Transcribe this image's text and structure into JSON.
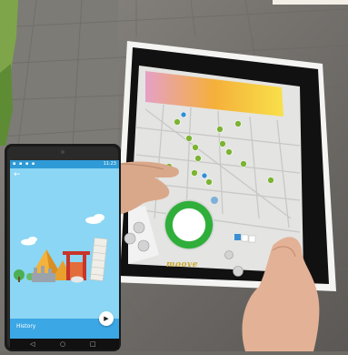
{
  "phone": {
    "status_time": "11:23",
    "history_label": "History"
  },
  "tablet": {
    "brand": "moove"
  }
}
